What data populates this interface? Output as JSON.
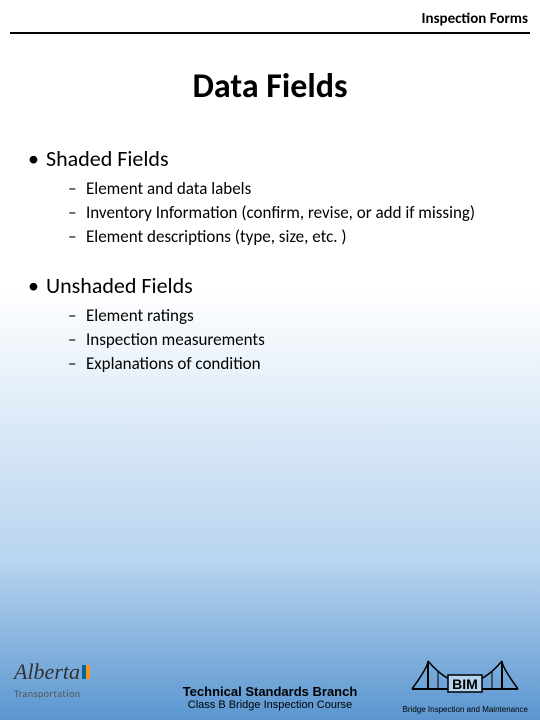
{
  "header": "Inspection Forms",
  "title": "Data Fields",
  "sections": [
    {
      "label": "Shaded Fields",
      "items": [
        "Element and data labels",
        "Inventory Information (confirm, revise, or add if missing)",
        "Element descriptions (type, size, etc. )"
      ]
    },
    {
      "label": "Unshaded Fields",
      "items": [
        "Element ratings",
        "Inspection measurements",
        "Explanations of condition"
      ]
    }
  ],
  "footer": {
    "left_brand": "Alberta",
    "left_sub": "Transportation",
    "center_line1": "Technical Standards Branch",
    "center_line2": "Class B Bridge Inspection Course",
    "right_acronym": "BIM",
    "right_caption": "Bridge Inspection and Maintenance"
  }
}
